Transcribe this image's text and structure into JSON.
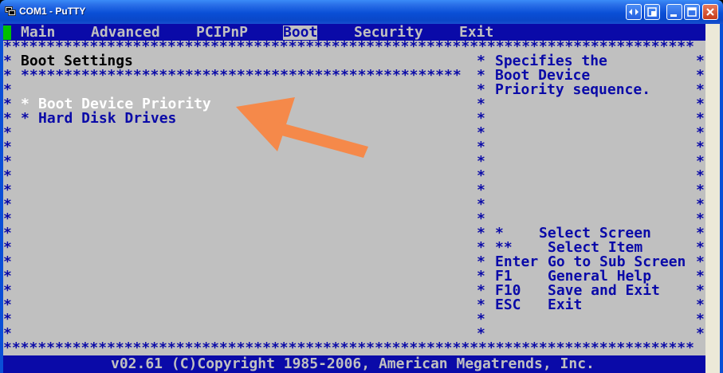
{
  "window": {
    "title": "COM1 - PuTTY"
  },
  "menu": {
    "items": [
      "Main",
      "Advanced",
      "PCIPnP",
      "Boot",
      "Security",
      "Exit"
    ],
    "selected": "Boot"
  },
  "main": {
    "section_title": "Boot Settings",
    "entries": [
      {
        "marker": "*",
        "label": "Boot Device Priority"
      },
      {
        "marker": "*",
        "label": "Hard Disk Drives"
      }
    ]
  },
  "help": {
    "description": [
      "Specifies the",
      "Boot Device",
      "Priority sequence."
    ],
    "keys": [
      {
        "key": "*",
        "desc": "Select Screen"
      },
      {
        "key": "**",
        "desc": "Select Item"
      },
      {
        "key": "Enter",
        "desc": "Go to Sub Screen"
      },
      {
        "key": "F1",
        "desc": "General Help"
      },
      {
        "key": "F10",
        "desc": "Save and Exit"
      },
      {
        "key": "ESC",
        "desc": "Exit"
      }
    ]
  },
  "footer": {
    "copyright": "v02.61 (C)Copyright 1985-2006, American Megatrends, Inc."
  },
  "colors": {
    "bios_blue": "#0a0aa8",
    "bios_gray": "#c0c0c0",
    "highlight_white": "#ffffff",
    "annotation_arrow": "#f5894a"
  }
}
